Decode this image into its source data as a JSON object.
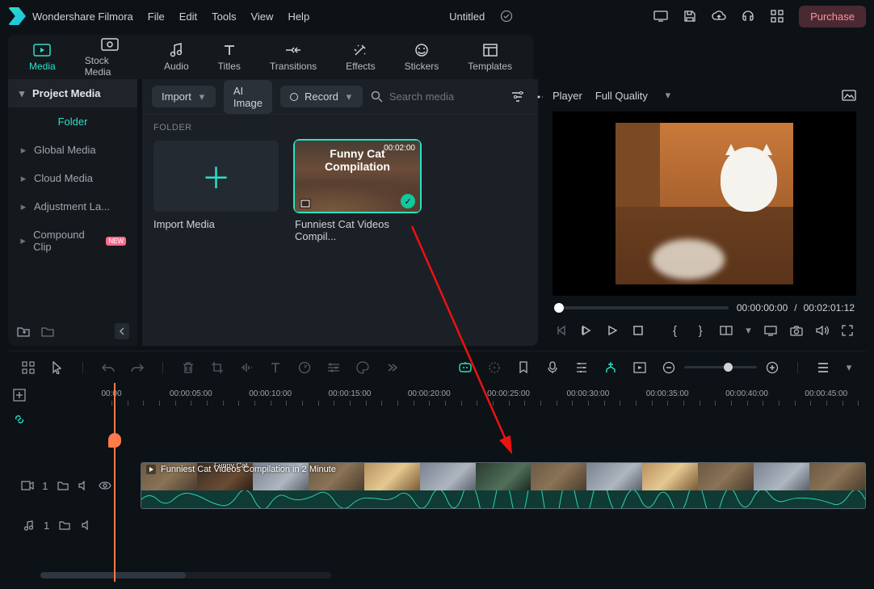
{
  "app_name": "Wondershare Filmora",
  "menu": {
    "file": "File",
    "edit": "Edit",
    "tools": "Tools",
    "view": "View",
    "help": "Help"
  },
  "project_title": "Untitled",
  "purchase_label": "Purchase",
  "tabs": {
    "media": "Media",
    "stock": "Stock Media",
    "audio": "Audio",
    "titles": "Titles",
    "transitions": "Transitions",
    "effects": "Effects",
    "stickers": "Stickers",
    "templates": "Templates"
  },
  "sidebar": {
    "header": "Project Media",
    "folder": "Folder",
    "items": [
      "Global Media",
      "Cloud Media",
      "Adjustment La...",
      "Compound Clip"
    ],
    "new_badge": "NEW"
  },
  "mid_toolbar": {
    "import": "Import",
    "ai_image": "AI Image",
    "record": "Record",
    "search_placeholder": "Search media"
  },
  "folder_label": "FOLDER",
  "cards": {
    "import": "Import Media",
    "clip_name": "Funniest Cat Videos Compil...",
    "clip_thumb_title1": "Funny Cat",
    "clip_thumb_title2": "Compilation",
    "clip_duration": "00:02:00"
  },
  "player": {
    "label": "Player",
    "quality": "Full Quality",
    "time_current": "00:00:00:00",
    "time_sep": "/",
    "time_total": "00:02:01:12",
    "brace_open": "{",
    "brace_close": "}"
  },
  "ruler": [
    "00:00",
    "00:00:05:00",
    "00:00:10:00",
    "00:00:15:00",
    "00:00:20:00",
    "00:00:25:00",
    "00:00:30:00",
    "00:00:35:00",
    "00:00:40:00",
    "00:00:45:00"
  ],
  "track": {
    "video_idx": "1",
    "audio_idx": "1",
    "clip_title": "Funniest Cat Videos Compilation in 2 Minute",
    "clip_overlay": "Funny Cat"
  }
}
